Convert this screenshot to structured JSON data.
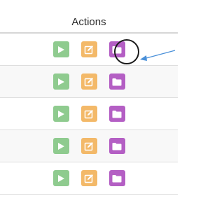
{
  "table": {
    "header": "Actions",
    "rows": [
      {
        "actions": [
          "run",
          "edit",
          "folder"
        ]
      },
      {
        "actions": [
          "run",
          "edit",
          "folder"
        ]
      },
      {
        "actions": [
          "run",
          "edit",
          "folder"
        ]
      },
      {
        "actions": [
          "run",
          "edit",
          "folder"
        ]
      },
      {
        "actions": [
          "run",
          "edit",
          "folder"
        ]
      }
    ]
  },
  "icons": {
    "run": "play-icon",
    "edit": "edit-icon",
    "folder": "folder-icon"
  },
  "colors": {
    "run": "#8fcb8f",
    "edit": "#f3b969",
    "folder": "#b45fc4",
    "highlight_ring": "#1a1a1a",
    "callout_arrow": "#4a90d9"
  },
  "annotation": {
    "highlighted_row": 0,
    "highlighted_action": "folder"
  }
}
